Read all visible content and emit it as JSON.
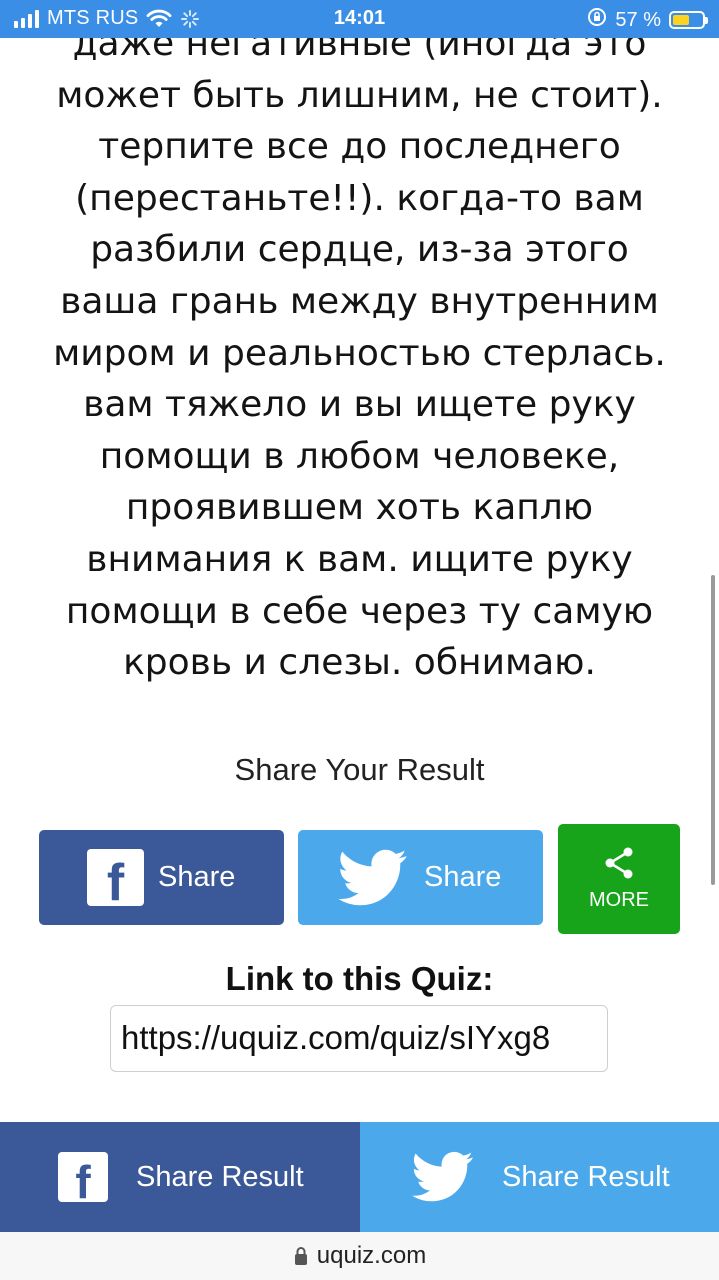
{
  "status_bar": {
    "carrier": "MTS RUS",
    "time": "14:01",
    "battery_percent": "57 %",
    "battery_level": 0.57,
    "battery_color": "#ffd21f"
  },
  "result": {
    "lines": [
      "даже негативные (иногда это",
      "может быть лишним, не стоит).",
      "терпите все до последнего",
      "(перестаньте!!). когда-то вам",
      "разбили сердце, из-за этого",
      "ваша грань между внутренним",
      "миром и реальностью стерлась.",
      "вам тяжело и вы ищете руку",
      "помощи в любом человеке,",
      "проявившем хоть каплю",
      "внимания к вам. ищите руку",
      "помощи в себе через ту самую",
      "кровь и слезы. обнимаю."
    ]
  },
  "share": {
    "heading": "Share Your Result",
    "facebook_label": "Share",
    "twitter_label": "Share",
    "more_label": "MORE"
  },
  "quiz_link": {
    "label": "Link to this Quiz:",
    "value": "https://uquiz.com/quiz/sIYxg8"
  },
  "bottom_bar": {
    "facebook_label": "Share Result",
    "twitter_label": "Share Result"
  },
  "browser": {
    "domain": "uquiz.com"
  },
  "colors": {
    "status_bar": "#3a8ee6",
    "facebook": "#3b5998",
    "twitter": "#4aa8eb",
    "more": "#17a31a"
  },
  "icons": {
    "signal": "cellular-signal-icon",
    "wifi": "wifi-icon",
    "loading": "loading-spinner-icon",
    "orientation_lock": "orientation-lock-icon",
    "battery": "battery-icon",
    "facebook": "facebook-icon",
    "twitter": "twitter-bird-icon",
    "share": "share-icon",
    "lock": "lock-icon"
  }
}
